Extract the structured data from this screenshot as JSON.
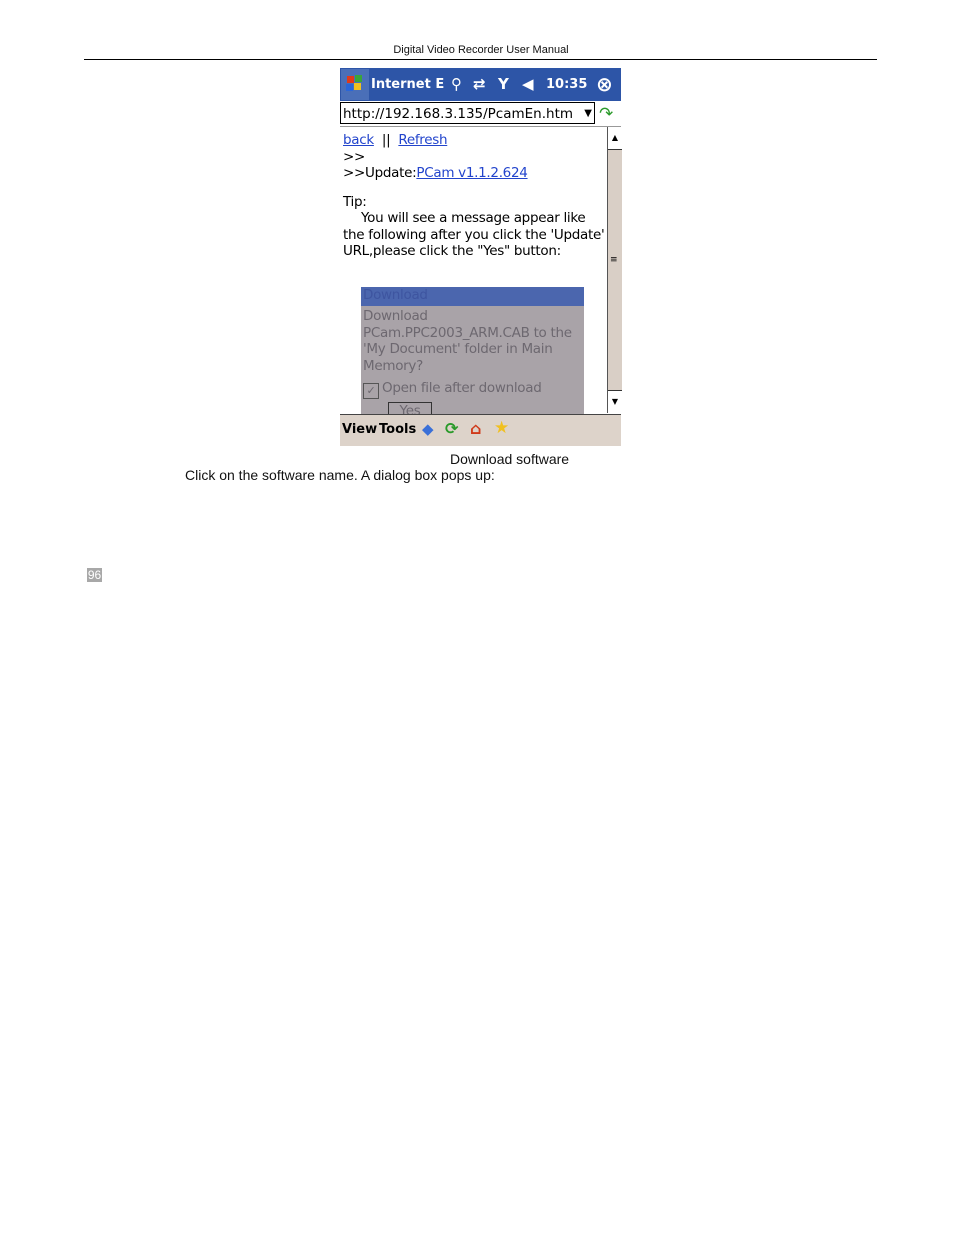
{
  "header": {
    "title": "Digital Video Recorder User Manual"
  },
  "screenshot": {
    "titlebar": {
      "app": "Internet E",
      "time": "10:35"
    },
    "address": "http://192.168.3.135/PcamEn.htm",
    "links": {
      "back": "back",
      "sep": "||",
      "refresh": "Refresh"
    },
    "line1": ">>",
    "update_prefix": ">>Update:",
    "update_link": "PCam v1.1.2.624",
    "tip_label": "Tip:",
    "tip_text": "You will see a message appear like the following after you click the 'Update' URL,please click the \"Yes\" button:",
    "dialog": {
      "title": "Download",
      "message": "Download PCam.PPC2003_ARM.CAB to the 'My Document' folder in Main Memory?",
      "checkbox": "Open file after download",
      "checked": true,
      "yes": "Yes"
    },
    "menu": {
      "view": "View",
      "tools": "Tools"
    }
  },
  "caption": "Download software",
  "body_text": "Click on the software name. A dialog box pops up:",
  "page_number": "96"
}
